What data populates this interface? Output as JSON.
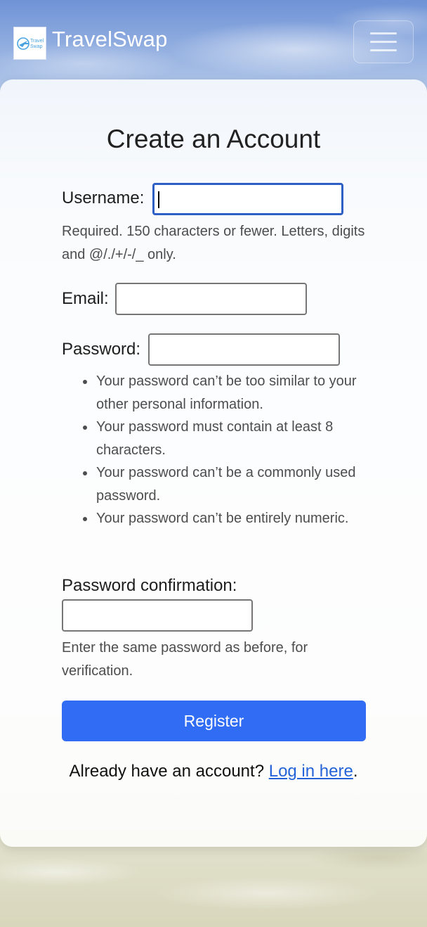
{
  "navbar": {
    "brand_name": "TravelSwap",
    "logo_text_line1": "Travel",
    "logo_text_line2": "Swap"
  },
  "form": {
    "title": "Create an Account",
    "username": {
      "label": "Username:",
      "value": "",
      "help": "Required. 150 characters or fewer. Letters, digits and @/./+/-/_ only."
    },
    "email": {
      "label": "Email:",
      "value": ""
    },
    "password": {
      "label": "Password:",
      "value": "",
      "rules": [
        "Your password can’t be too similar to your other personal information.",
        "Your password must contain at least 8 characters.",
        "Your password can’t be a commonly used password.",
        "Your password can’t be entirely numeric."
      ]
    },
    "password_confirmation": {
      "label": "Password confirmation:",
      "value": "",
      "help": "Enter the same password as before, for verification."
    },
    "register_label": "Register",
    "login_prompt": "Already have an account?",
    "login_link": "Log in here",
    "login_suffix": "."
  },
  "colors": {
    "primary_button": "#316cf4",
    "link": "#2563d8",
    "focus_border": "#2d5fc4"
  }
}
